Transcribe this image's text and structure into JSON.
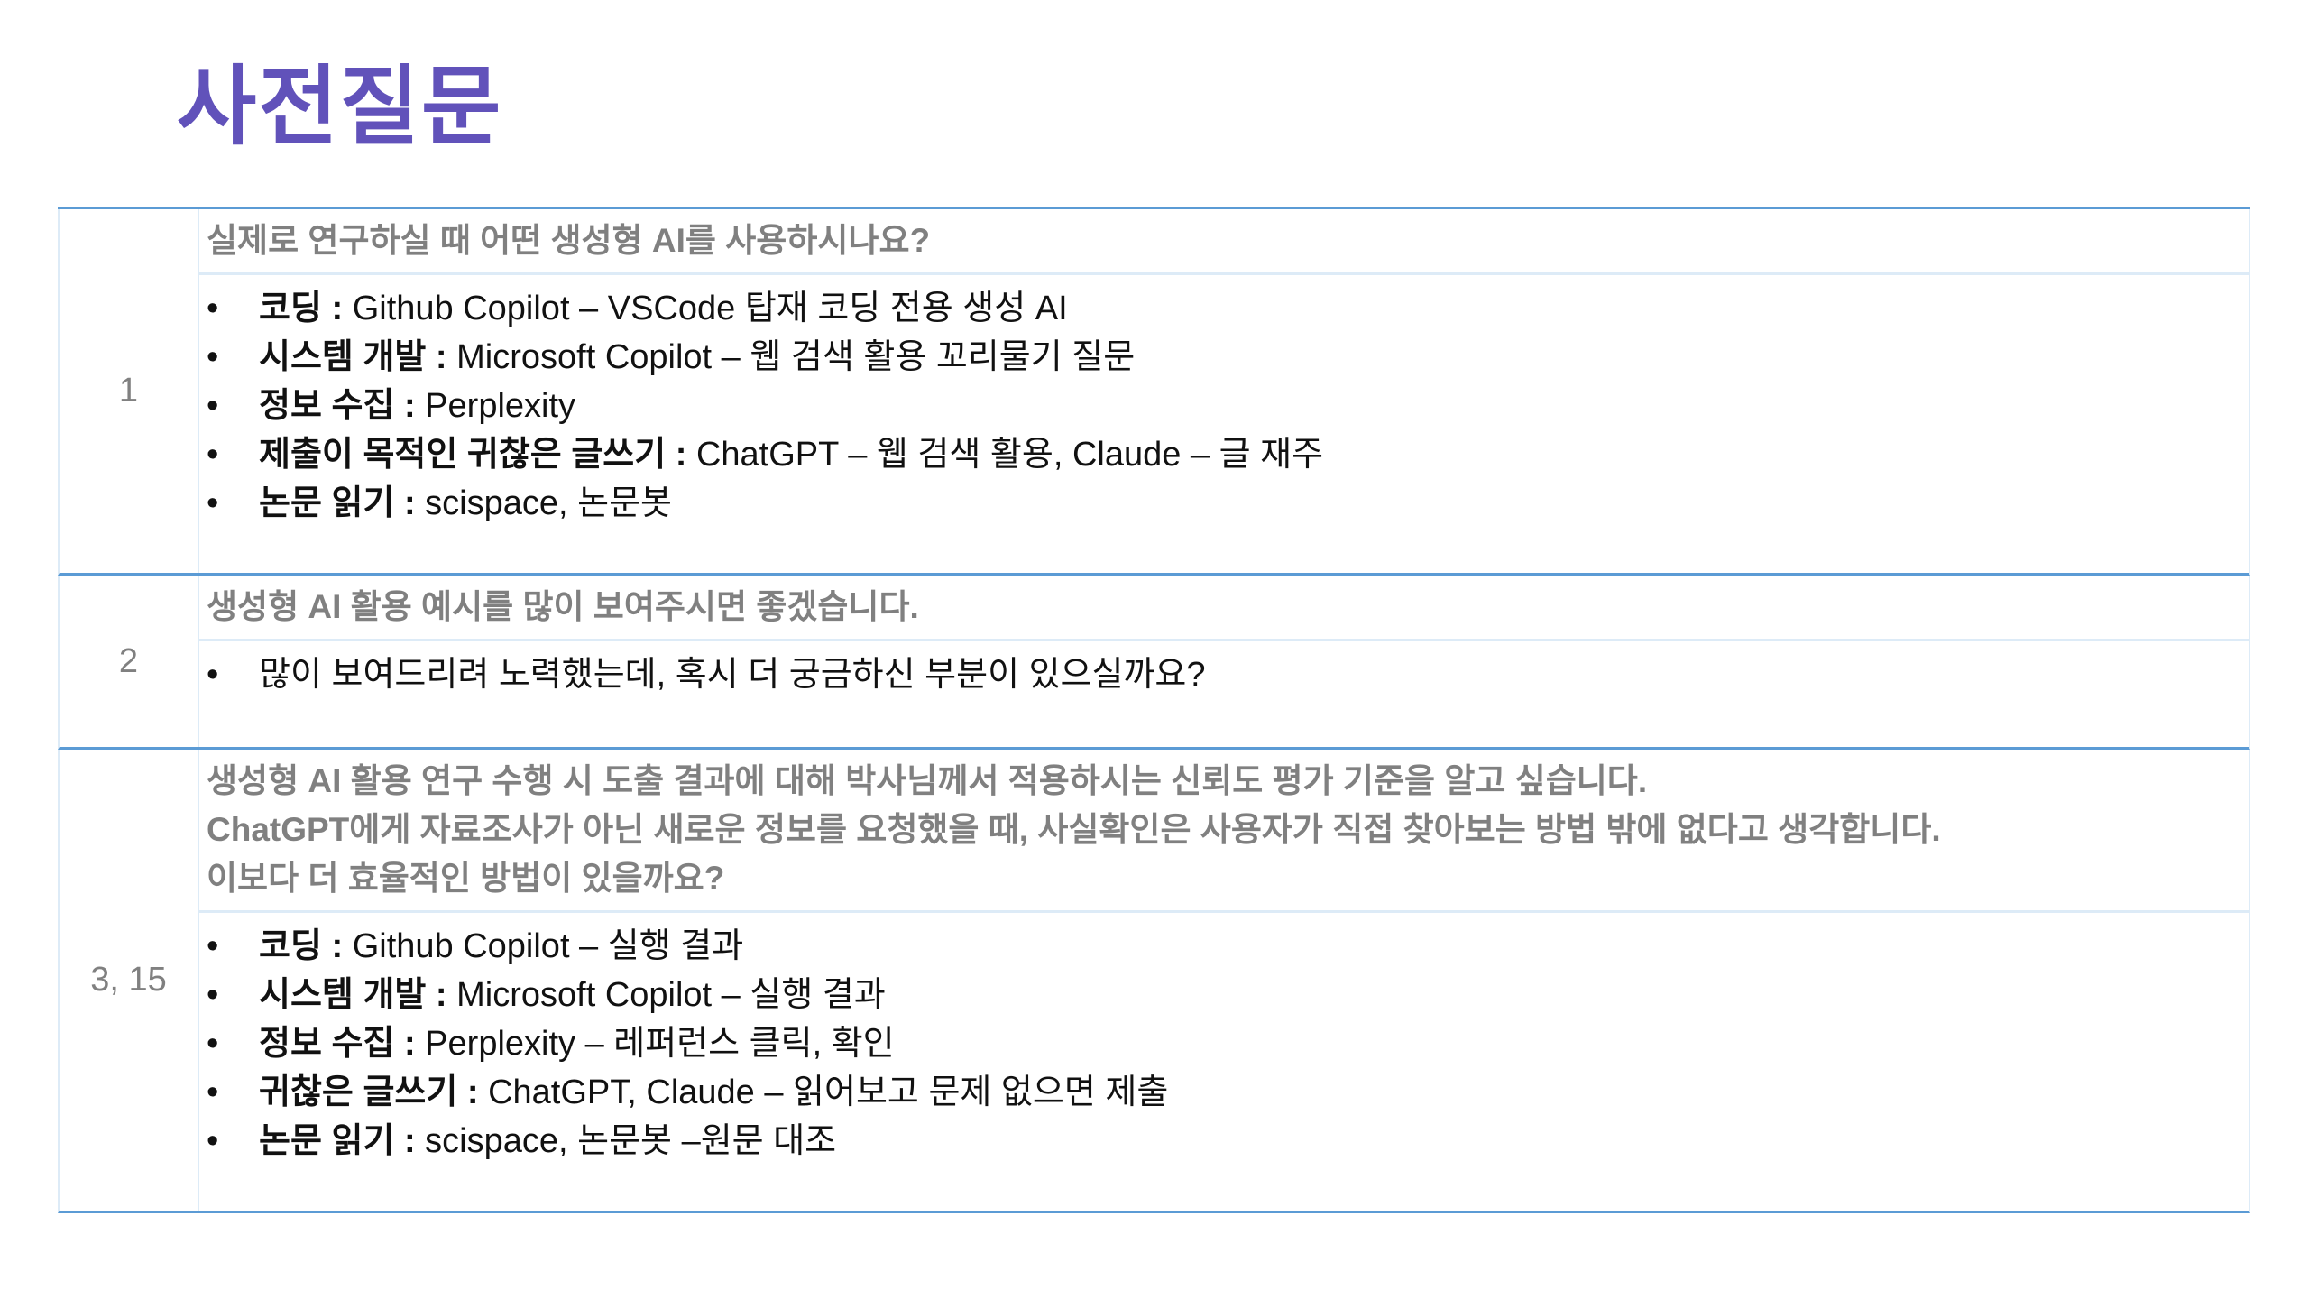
{
  "title": "사전질문",
  "rows": [
    {
      "number": "1",
      "question": "실제로 연구하실 때 어떤 생성형 AI를 사용하시나요?",
      "answers": [
        {
          "label": "코딩 :",
          "text": " Github Copilot – VSCode 탑재 코딩 전용 생성 AI"
        },
        {
          "label": "시스템 개발 :",
          "text": " Microsoft Copilot – 웹 검색 활용 꼬리물기 질문"
        },
        {
          "label": "정보 수집 :",
          "text": " Perplexity"
        },
        {
          "label": "제출이 목적인 귀찮은 글쓰기 :",
          "text": " ChatGPT – 웹 검색 활용, Claude – 글 재주"
        },
        {
          "label": "논문 읽기 :",
          "text": " scispace, 논문봇"
        }
      ]
    },
    {
      "number": "2",
      "question": "생성형 AI 활용 예시를 많이 보여주시면 좋겠습니다.",
      "answers": [
        {
          "label": "",
          "text": "많이 보여드리려 노력했는데, 혹시 더 궁금하신 부분이 있으실까요?"
        }
      ]
    },
    {
      "number": "3, 15",
      "question_lines": [
        "생성형 AI 활용 연구 수행 시 도출 결과에 대해 박사님께서 적용하시는 신뢰도 평가 기준을 알고 싶습니다.",
        "ChatGPT에게 자료조사가 아닌 새로운 정보를 요청했을 때, 사실확인은 사용자가 직접 찾아보는 방법 밖에 없다고 생각합니다.",
        "이보다 더 효율적인 방법이 있을까요?"
      ],
      "answers": [
        {
          "label": "코딩 :",
          "text": " Github Copilot – 실행 결과"
        },
        {
          "label": "시스템 개발 :",
          "text": " Microsoft Copilot – 실행 결과"
        },
        {
          "label": "정보 수집 :",
          "text": " Perplexity – 레퍼런스 클릭, 확인"
        },
        {
          "label": "귀찮은 글쓰기 :",
          "text": " ChatGPT, Claude – 읽어보고 문제 없으면 제출"
        },
        {
          "label": "논문 읽기 :",
          "text": " scispace, 논문봇 –원문 대조"
        }
      ]
    }
  ]
}
